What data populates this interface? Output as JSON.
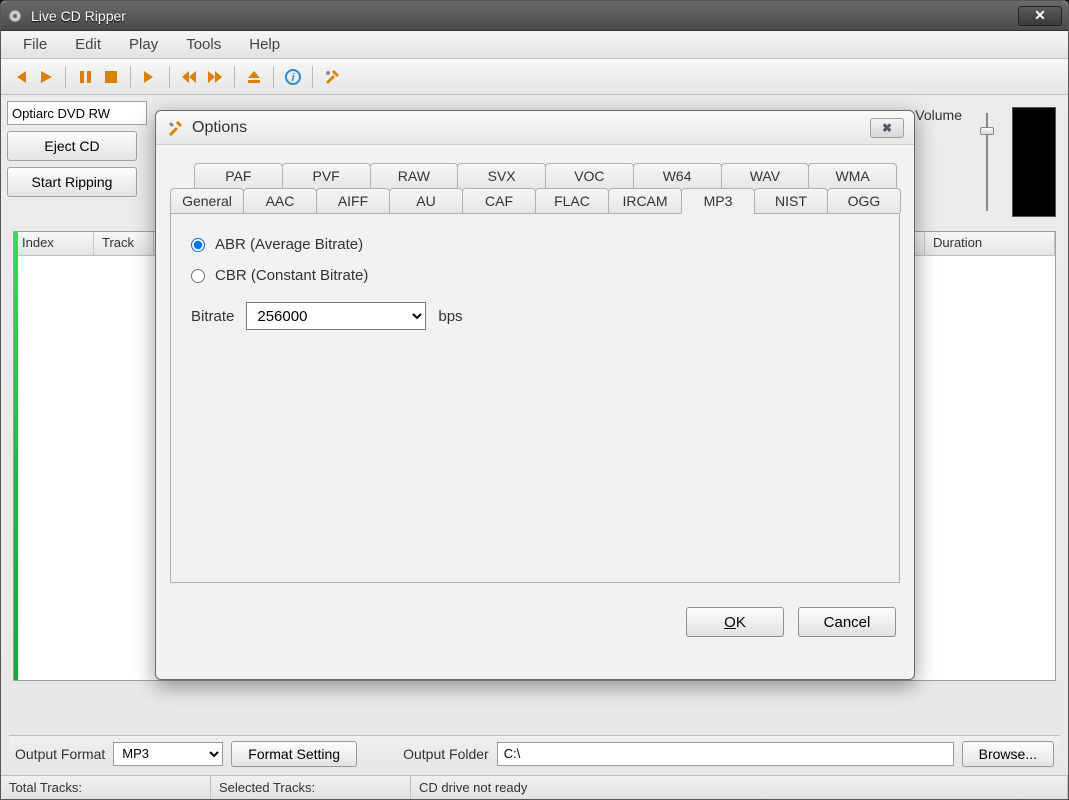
{
  "window": {
    "title": "Live CD Ripper"
  },
  "menu": [
    "File",
    "Edit",
    "Play",
    "Tools",
    "Help"
  ],
  "toolbar_icons": [
    "skip-prev",
    "play",
    "pause",
    "stop",
    "skip-next",
    "rewind",
    "fast-forward",
    "eject",
    "info",
    "tools"
  ],
  "drive": "Optiarc DVD RW",
  "left_buttons": {
    "eject": "Eject CD",
    "start": "Start Ripping"
  },
  "volume_label": "Volume",
  "grid": {
    "cols": [
      "Index",
      "Track",
      "",
      "Duration"
    ]
  },
  "bottom": {
    "output_format_label": "Output Format",
    "output_format_value": "MP3",
    "format_setting": "Format Setting",
    "output_folder_label": "Output Folder",
    "output_folder_value": "C:\\",
    "browse": "Browse..."
  },
  "status": {
    "total": "Total Tracks:",
    "selected": "Selected Tracks:",
    "drive": "CD drive not ready"
  },
  "dialog": {
    "title": "Options",
    "tabs_row1": [
      "PAF",
      "PVF",
      "RAW",
      "SVX",
      "VOC",
      "W64",
      "WAV",
      "WMA"
    ],
    "tabs_row2": [
      "General",
      "AAC",
      "AIFF",
      "AU",
      "CAF",
      "FLAC",
      "IRCAM",
      "MP3",
      "NIST",
      "OGG"
    ],
    "active_tab": "MP3",
    "radio_abr": "ABR (Average Bitrate)",
    "radio_cbr": "CBR (Constant Bitrate)",
    "bitrate_label": "Bitrate",
    "bitrate_value": "256000",
    "bitrate_unit": "bps",
    "ok": "OK",
    "cancel": "Cancel"
  }
}
